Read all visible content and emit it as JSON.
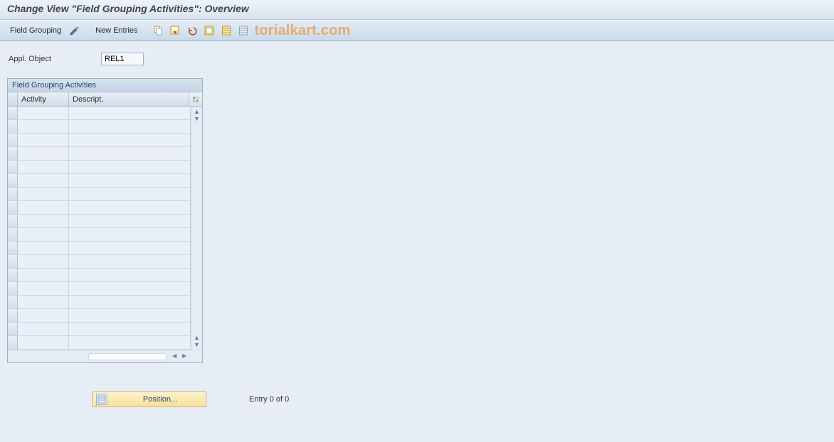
{
  "title": "Change View \"Field Grouping Activities\": Overview",
  "toolbar": {
    "field_grouping_label": "Field Grouping",
    "new_entries_label": "New Entries",
    "icons": {
      "edit": "edit-icon",
      "copy": "copy-icon",
      "save": "save-icon",
      "undo": "undo-icon",
      "select_all": "select-all-icon",
      "sheet": "sheet-icon",
      "sheet2": "sheet2-icon"
    }
  },
  "watermark_text": "torialkart.com",
  "appl_object": {
    "label": "Appl. Object",
    "value": "REL1"
  },
  "table": {
    "title": "Field Grouping Activities",
    "columns": {
      "activity": "Activity",
      "descript": "Descript."
    },
    "rows": [
      {
        "activity": "",
        "descript": ""
      },
      {
        "activity": "",
        "descript": ""
      },
      {
        "activity": "",
        "descript": ""
      },
      {
        "activity": "",
        "descript": ""
      },
      {
        "activity": "",
        "descript": ""
      },
      {
        "activity": "",
        "descript": ""
      },
      {
        "activity": "",
        "descript": ""
      },
      {
        "activity": "",
        "descript": ""
      },
      {
        "activity": "",
        "descript": ""
      },
      {
        "activity": "",
        "descript": ""
      },
      {
        "activity": "",
        "descript": ""
      },
      {
        "activity": "",
        "descript": ""
      },
      {
        "activity": "",
        "descript": ""
      },
      {
        "activity": "",
        "descript": ""
      },
      {
        "activity": "",
        "descript": ""
      },
      {
        "activity": "",
        "descript": ""
      },
      {
        "activity": "",
        "descript": ""
      },
      {
        "activity": "",
        "descript": ""
      }
    ]
  },
  "footer": {
    "position_label": "Position...",
    "entry_text": "Entry 0 of 0"
  }
}
